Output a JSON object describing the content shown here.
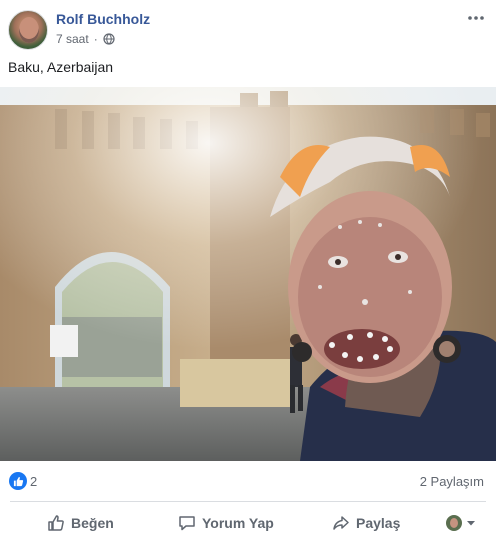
{
  "post": {
    "author": "Rolf Buchholz",
    "time": "7 saat",
    "separator": "·",
    "text": "Baku, Azerbaijan",
    "photo_alt": "Baku, Azerbaijan"
  },
  "stats": {
    "like_count": "2",
    "share_count": "2 Paylaşım"
  },
  "actions": {
    "like": "Beğen",
    "comment": "Yorum Yap",
    "share": "Paylaş"
  },
  "icons": {
    "header": [
      "globe-icon",
      "more-icon"
    ],
    "actions": [
      "thumbs-up-icon",
      "comment-icon",
      "share-icon",
      "chevron-down-icon"
    ]
  },
  "colors": {
    "author_link": "#385898",
    "like_blue": "#1877f2",
    "muted": "#616770"
  }
}
